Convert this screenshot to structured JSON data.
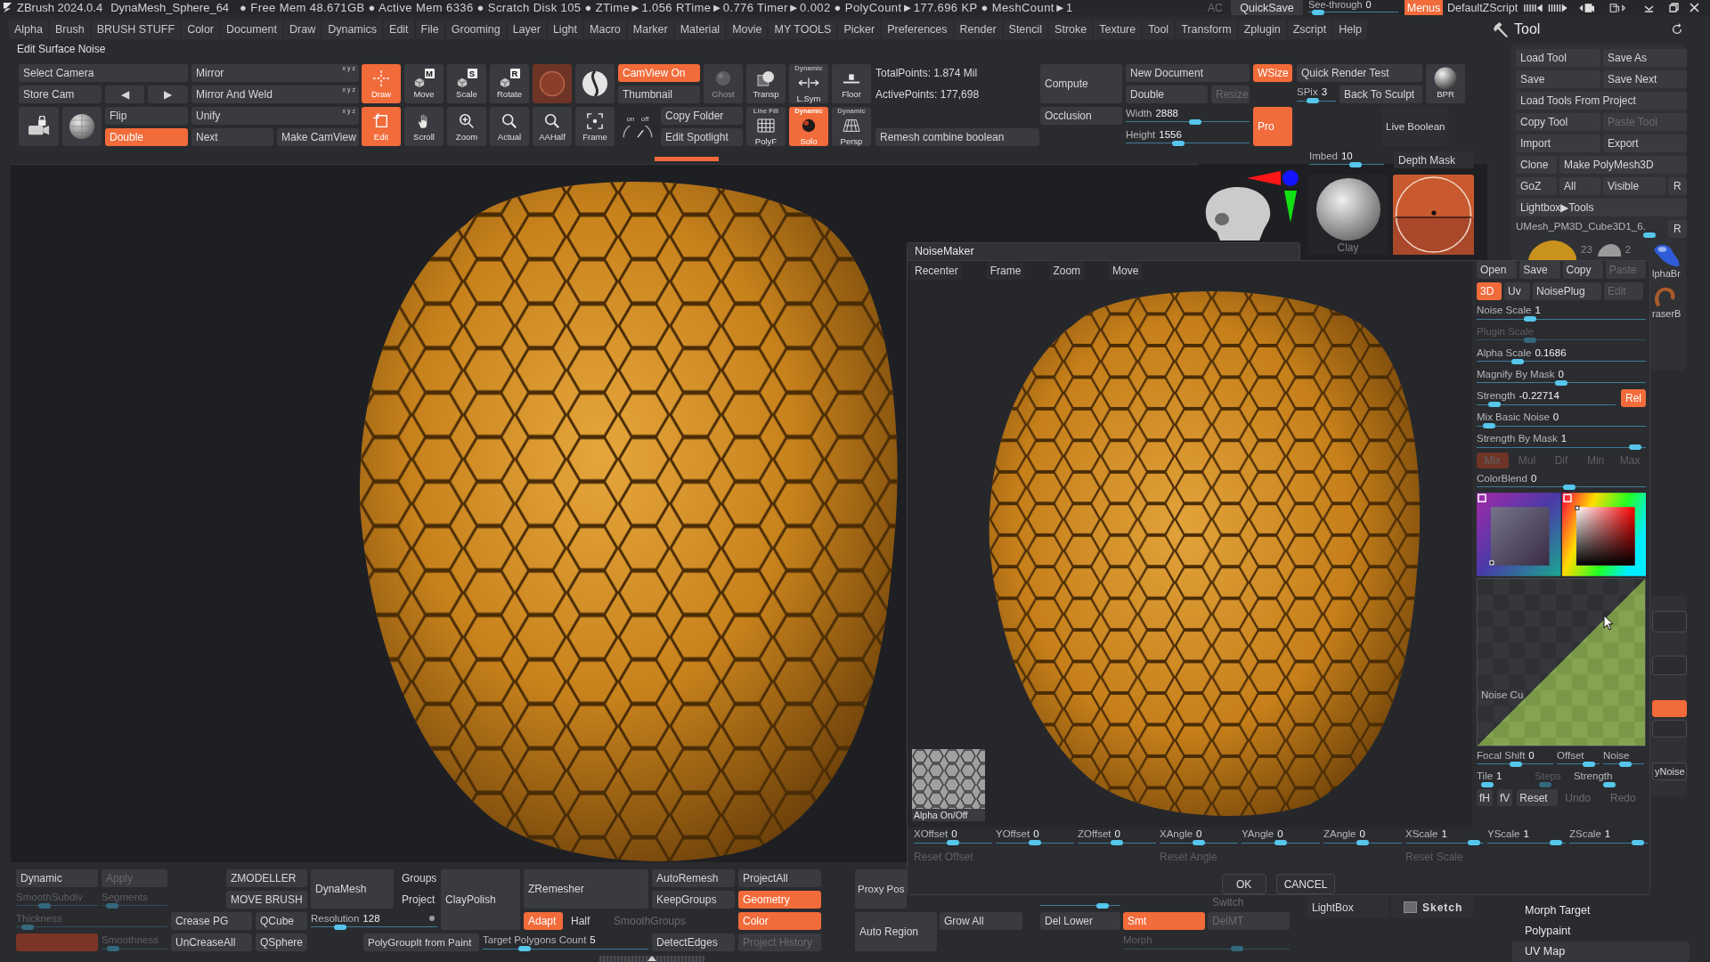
{
  "title_bar": {
    "app_name": "ZBrush 2024.0.4",
    "document": "DynaMesh_Sphere_64",
    "status": "● Free Mem 48.671GB ● Active Mem 6336 ● Scratch Disk 105 ● ZTime►1.056 RTime►0.776 Timer►0.002 ● PolyCount►177.696 KP ● MeshCount►1",
    "ac_label": "AC",
    "quicksave": "QuickSave",
    "see_through": {
      "label": "See-through",
      "value": "0",
      "level": 0.05
    },
    "menus": {
      "text": "Menus",
      "on": true
    },
    "script": "DefaultZScript"
  },
  "menu_bar": [
    "Alpha",
    "Brush",
    "BRUSH STUFF",
    "Color",
    "Document",
    "Draw",
    "Dynamics",
    "Edit",
    "File",
    "Grooming",
    "Layer",
    "Light",
    "Macro",
    "Marker",
    "Material",
    "Movie",
    "MY TOOLS",
    "Picker",
    "Preferences",
    "Render",
    "Stencil",
    "Stroke",
    "Texture",
    "Tool",
    "Transform",
    "Zplugin",
    "Zscript",
    "Help"
  ],
  "tool_panel_title": "Tool",
  "palette_title": "Edit Surface Noise",
  "toolbar": {
    "camera": [
      {
        "kind": "button",
        "text": "Select Camera",
        "on": false
      },
      {
        "kind": "button",
        "text": "Mirror",
        "axes": "x y z",
        "on": false
      },
      {
        "kind": "button",
        "text": "Store Cam",
        "on": false
      },
      {
        "kind": "button",
        "text": "◀",
        "on": false
      },
      {
        "kind": "button",
        "text": "▶",
        "on": false
      },
      {
        "kind": "button",
        "text": "Mirror And Weld",
        "axes": "x y z",
        "on": false
      },
      {
        "kind": "icon",
        "on": false
      },
      {
        "kind": "icon",
        "on": false
      },
      {
        "kind": "button",
        "text": "Flip",
        "on": false
      },
      {
        "kind": "button",
        "text": "Unify",
        "axes": "x y z",
        "on": false
      },
      {
        "kind": "button",
        "text": "Double",
        "on": true
      },
      {
        "kind": "button",
        "text": "Next",
        "on": false
      },
      {
        "kind": "button",
        "text": "Make CamView",
        "on": false
      }
    ],
    "transform": [
      {
        "kind": "tool",
        "text": "Draw",
        "on": true
      },
      {
        "kind": "tool",
        "text": "Move",
        "letter": "M",
        "on": false
      },
      {
        "kind": "tool",
        "text": "Scale",
        "letter": "S",
        "on": false
      },
      {
        "kind": "tool",
        "text": "Rotate",
        "letter": "R",
        "on": false
      },
      {
        "kind": "swatch",
        "on": false
      },
      {
        "kind": "icon",
        "on": false
      },
      {
        "kind": "tool",
        "text": "Edit",
        "on": true
      },
      {
        "kind": "tool",
        "text": "Scroll",
        "on": false
      },
      {
        "kind": "tool",
        "text": "Zoom",
        "on": false
      },
      {
        "kind": "tool",
        "text": "Actual",
        "on": false
      },
      {
        "kind": "tool",
        "text": "AAHalf",
        "on": false
      },
      {
        "kind": "tool",
        "text": "Frame",
        "on": false
      }
    ],
    "display": [
      {
        "kind": "button",
        "text": "CamView On",
        "on": true,
        "disabled": false
      },
      {
        "kind": "button",
        "text": "Thumbnail",
        "on": false,
        "disabled": false
      },
      {
        "kind": "tool",
        "text": "Ghost",
        "on": false,
        "disabled": true
      },
      {
        "kind": "toggle",
        "on_label": "on",
        "off_label": "off"
      },
      {
        "kind": "button",
        "text": "Copy Folder",
        "on": false,
        "disabled": false
      },
      {
        "kind": "button",
        "text": "Edit Spotlight",
        "on": false,
        "disabled": false
      }
    ],
    "view": [
      {
        "kind": "tool",
        "text": "Transp",
        "on": false
      },
      {
        "kind": "tool",
        "text": "L.Sym",
        "caption": "Dynamic",
        "on": false
      },
      {
        "kind": "tool",
        "text": "Floor",
        "on": false
      },
      {
        "kind": "tool",
        "text": "PolyF",
        "caption": "Line Fill",
        "on": false
      },
      {
        "kind": "tool",
        "text": "Solo",
        "caption": "Dynamic",
        "on": true
      },
      {
        "kind": "tool",
        "text": "Persp",
        "caption": "Dynamic",
        "on": false
      }
    ],
    "stats": [
      {
        "kind": "label",
        "text": "TotalPoints: 1.874 Mil"
      },
      {
        "kind": "label",
        "text": "ActivePoints: 177,698"
      },
      {
        "kind": "button",
        "text": "Remesh combine boolean",
        "on": false
      }
    ],
    "compute": [
      {
        "kind": "button",
        "text": "Compute",
        "on": false
      },
      {
        "kind": "button",
        "text": "Occlusion",
        "on": false
      }
    ],
    "document": [
      {
        "kind": "button",
        "text": "New Document",
        "on": false,
        "disabled": false
      },
      {
        "kind": "button",
        "text": "WSize",
        "on": true,
        "disabled": false
      },
      {
        "kind": "button",
        "text": "Double",
        "on": false,
        "disabled": false
      },
      {
        "kind": "button",
        "text": "Resize",
        "on": false,
        "disabled": true
      },
      {
        "kind": "slider",
        "label": "Width",
        "value": "2888",
        "level": 0.57
      },
      {
        "kind": "slider",
        "label": "Height",
        "value": "1556",
        "level": 0.42
      },
      {
        "kind": "button",
        "text": "Pro",
        "on": true,
        "disabled": false
      }
    ],
    "bpr": [
      {
        "kind": "button",
        "text": "Quick Render Test",
        "on": false
      },
      {
        "kind": "slider",
        "label": "SPix",
        "value": "3",
        "level": 0.38
      },
      {
        "kind": "button",
        "text": "Back To Sculpt",
        "on": false
      },
      {
        "kind": "tool",
        "text": "BPR",
        "on": false
      },
      {
        "kind": "button",
        "text": "Live Boolean",
        "on": false
      }
    ]
  },
  "shelf": {
    "imbed": {
      "label": "Imbed",
      "value": "10",
      "level": 0.64
    },
    "depth_mask": "Depth Mask",
    "material_label": "Clay"
  },
  "noise_maker": {
    "title": "NoiseMaker",
    "view_buttons": [
      "Recenter",
      "Frame",
      "Zoom",
      "Move"
    ],
    "alpha_label": "Alpha On/Off",
    "file_buttons": [
      {
        "text": "Open",
        "disabled": false
      },
      {
        "text": "Save",
        "disabled": false
      },
      {
        "text": "Copy",
        "disabled": false
      },
      {
        "text": "Paste",
        "disabled": true
      }
    ],
    "modes": [
      {
        "text": "3D",
        "selected": true,
        "disabled": false
      },
      {
        "text": "Uv",
        "selected": false,
        "disabled": false
      },
      {
        "text": "NoisePlug",
        "selected": false,
        "disabled": false
      },
      {
        "text": "Edit",
        "selected": false,
        "disabled": true
      }
    ],
    "sliders": [
      {
        "label": "Noise Scale",
        "value": "1",
        "level": 0.3,
        "disabled": false
      },
      {
        "label": "Plugin Scale",
        "level": 0.3,
        "disabled": true
      },
      {
        "label": "Alpha Scale",
        "value": "0.1686",
        "level": 0.22,
        "disabled": false
      },
      {
        "label": "Magnify By Mask",
        "value": "0",
        "level": 0.5,
        "disabled": false
      },
      {
        "label": "Strength",
        "value": "-0.22714",
        "level": 0.09,
        "disabled": false,
        "toggle": {
          "text": "Rel",
          "on": true
        }
      },
      {
        "label": "Mix Basic Noise",
        "value": "0",
        "level": 0.04,
        "disabled": false
      },
      {
        "label": "Strength By Mask",
        "value": "1",
        "level": 0.97,
        "disabled": false
      }
    ],
    "blend_modes": [
      {
        "text": "Mix",
        "selected": true,
        "disabled": true
      },
      {
        "text": "Mul",
        "selected": false,
        "disabled": true
      },
      {
        "text": "Dif",
        "selected": false,
        "disabled": true
      },
      {
        "text": "Min",
        "selected": false,
        "disabled": true
      },
      {
        "text": "Max",
        "selected": false,
        "disabled": true
      }
    ],
    "color_blend": {
      "label": "ColorBlend",
      "value": "0",
      "level": 0.55
    },
    "curve_label": "Noise Cu",
    "curve_sliders": [
      {
        "label": "Focal Shift",
        "value": "0",
        "level": 0.52,
        "disabled": false
      },
      {
        "label": "Offset",
        "level": 0.84,
        "disabled": false
      },
      {
        "label": "Noise",
        "level": 0.55,
        "disabled": false
      },
      {
        "label": "Tile",
        "value": "1",
        "level": 0.1,
        "disabled": false
      },
      {
        "label": "Steps",
        "level": 0.2,
        "disabled": true
      },
      {
        "label": "Strength",
        "level": 0.5,
        "disabled": false
      }
    ],
    "curve_buttons": [
      {
        "text": "fH",
        "disabled": false
      },
      {
        "text": "fV",
        "disabled": false
      },
      {
        "text": "Reset",
        "disabled": false
      },
      {
        "text": "Undo",
        "disabled": true
      },
      {
        "text": "Redo",
        "disabled": true
      }
    ],
    "transform_sliders": [
      {
        "label": "XOffset",
        "value": "0",
        "level": 0.5
      },
      {
        "label": "YOffset",
        "value": "0",
        "level": 0.5
      },
      {
        "label": "ZOffset",
        "value": "0",
        "level": 0.5
      },
      {
        "label": "XAngle",
        "value": "0",
        "level": 0.5
      },
      {
        "label": "YAngle",
        "value": "0",
        "level": 0.5
      },
      {
        "label": "ZAngle",
        "value": "0",
        "level": 0.5
      },
      {
        "label": "XScale",
        "value": "1",
        "level": 0.95
      },
      {
        "label": "YScale",
        "value": "1",
        "level": 0.95
      },
      {
        "label": "ZScale",
        "value": "1",
        "level": 0.95
      }
    ],
    "reset_buttons": [
      {
        "text": "Reset Offset",
        "disabled": true
      },
      {
        "text": "Reset Angle",
        "disabled": true
      },
      {
        "text": "Reset Scale",
        "disabled": true
      }
    ],
    "actions": [
      "OK",
      "CANCEL"
    ]
  },
  "tool_panel": {
    "buttons": [
      {
        "text": "Load Tool",
        "disabled": false
      },
      {
        "text": "Save As",
        "disabled": false
      },
      {
        "text": "Save",
        "disabled": false
      },
      {
        "text": "Save Next",
        "disabled": false
      },
      {
        "text": "Load Tools From Project",
        "disabled": false
      },
      {
        "text": "Copy Tool",
        "disabled": false
      },
      {
        "text": "Paste Tool",
        "disabled": true
      },
      {
        "text": "Import",
        "disabled": false
      },
      {
        "text": "Export",
        "disabled": false
      },
      {
        "text": "Clone",
        "disabled": false
      },
      {
        "text": "Make PolyMesh3D",
        "disabled": false
      },
      {
        "text": "GoZ",
        "disabled": false
      },
      {
        "text": "All",
        "disabled": false
      },
      {
        "text": "Visible",
        "disabled": false
      },
      {
        "text": "R",
        "disabled": false
      },
      {
        "text": "Lightbox▶Tools",
        "disabled": false
      }
    ],
    "subtool_slider": {
      "label": "UMesh_PM3D_Cube3D1_6.",
      "level": 0.93
    },
    "subtool_r": "R",
    "thumbnail_counts": [
      "23",
      "2"
    ],
    "brush_labels": [
      "lphaBr",
      "raserB"
    ],
    "side_slots": [
      {
        "kind": "slot",
        "on": false
      },
      {
        "kind": "slot",
        "on": false
      },
      {
        "kind": "slot",
        "on": true
      },
      {
        "kind": "slot",
        "on": false
      },
      {
        "kind": "button",
        "text": "yNoise",
        "on": false
      }
    ],
    "sections": [
      {
        "text": "Morph Target",
        "selected": false
      },
      {
        "text": "Polypaint",
        "selected": false
      },
      {
        "text": "UV Map",
        "selected": true
      }
    ]
  },
  "bottom_bar": [
    {
      "kind": "button",
      "text": "Dynamic",
      "on": false,
      "disabled": false
    },
    {
      "kind": "button",
      "text": "Apply",
      "on": false,
      "disabled": true
    },
    {
      "kind": "slider",
      "label": "SmoothSubdiv",
      "level": 0.32,
      "disabled": true
    },
    {
      "kind": "slider",
      "label": "Segments",
      "level": 0.08,
      "disabled": true
    },
    {
      "kind": "slider",
      "label": "Thickness",
      "level": 0.04,
      "disabled": true
    },
    {
      "kind": "blank",
      "on": true,
      "disabled": true
    },
    {
      "kind": "slider",
      "label": "Smoothness",
      "level": 0.1,
      "disabled": true
    },
    {
      "kind": "button",
      "text": "ZMODELLER",
      "on": false,
      "disabled": false
    },
    {
      "kind": "button",
      "text": "MOVE BRUSH",
      "on": false,
      "disabled": false
    },
    {
      "kind": "button",
      "text": "Crease PG",
      "on": false,
      "disabled": false
    },
    {
      "kind": "button",
      "text": "QCube",
      "on": false,
      "disabled": false
    },
    {
      "kind": "button",
      "text": "UnCreaseAll",
      "on": false,
      "disabled": false
    },
    {
      "kind": "button",
      "text": "QSphere",
      "on": false,
      "disabled": false
    },
    {
      "kind": "button",
      "text": "DynaMesh",
      "on": false,
      "disabled": false
    },
    {
      "kind": "button",
      "text": "Groups",
      "on": false,
      "disabled": false
    },
    {
      "kind": "button",
      "text": "Project",
      "on": false,
      "disabled": false
    },
    {
      "kind": "slider",
      "label": "Resolution",
      "value": "128",
      "level": 0.2,
      "disabled": false
    },
    {
      "kind": "button",
      "text": "ClayPolish",
      "on": false,
      "disabled": false
    },
    {
      "kind": "button",
      "text": "PolyGroupIt from Paint",
      "on": false,
      "disabled": false
    },
    {
      "kind": "button",
      "text": "ZRemesher",
      "on": false,
      "disabled": false
    },
    {
      "kind": "button",
      "text": "Adapt",
      "on": true,
      "disabled": false
    },
    {
      "kind": "button",
      "text": "Half",
      "on": false,
      "disabled": false
    },
    {
      "kind": "button",
      "text": "SmoothGroups",
      "on": false,
      "disabled": true
    },
    {
      "kind": "slider",
      "label": "Target Polygons Count",
      "value": "5",
      "level": 0.23,
      "disabled": false
    },
    {
      "kind": "button",
      "text": "AutoRemesh",
      "on": false,
      "disabled": false
    },
    {
      "kind": "button",
      "text": "KeepGroups",
      "on": false,
      "disabled": false
    },
    {
      "kind": "button",
      "text": "DetectEdges",
      "on": false,
      "disabled": false
    },
    {
      "kind": "button",
      "text": "ProjectAll",
      "on": false,
      "disabled": false
    },
    {
      "kind": "button",
      "text": "Geometry",
      "on": true,
      "disabled": false
    },
    {
      "kind": "button",
      "text": "Color",
      "on": true,
      "disabled": false
    },
    {
      "kind": "button",
      "text": "Project History",
      "on": false,
      "disabled": true
    }
  ],
  "bottom_bar_right": [
    {
      "kind": "button",
      "text": "Proxy Pos",
      "on": false,
      "disabled": false
    },
    {
      "kind": "button",
      "text": "Auto Region",
      "on": false,
      "disabled": false
    },
    {
      "kind": "button",
      "text": "Grow All",
      "on": false,
      "disabled": false
    },
    {
      "kind": "slider",
      "level": 0.83
    },
    {
      "kind": "button",
      "text": "Switch",
      "on": false,
      "disabled": true
    },
    {
      "kind": "button",
      "text": "Del Lower",
      "on": false,
      "disabled": false
    },
    {
      "kind": "button",
      "text": "Smt",
      "on": true,
      "disabled": false
    },
    {
      "kind": "button",
      "text": "DelMT",
      "on": false,
      "disabled": true
    },
    {
      "kind": "slider",
      "label": "Morph",
      "level": 0.7,
      "disabled": true
    },
    {
      "kind": "button",
      "text": "LightBox",
      "on": false,
      "disabled": false
    },
    {
      "kind": "check",
      "text": "Sketch",
      "checked": false
    }
  ]
}
